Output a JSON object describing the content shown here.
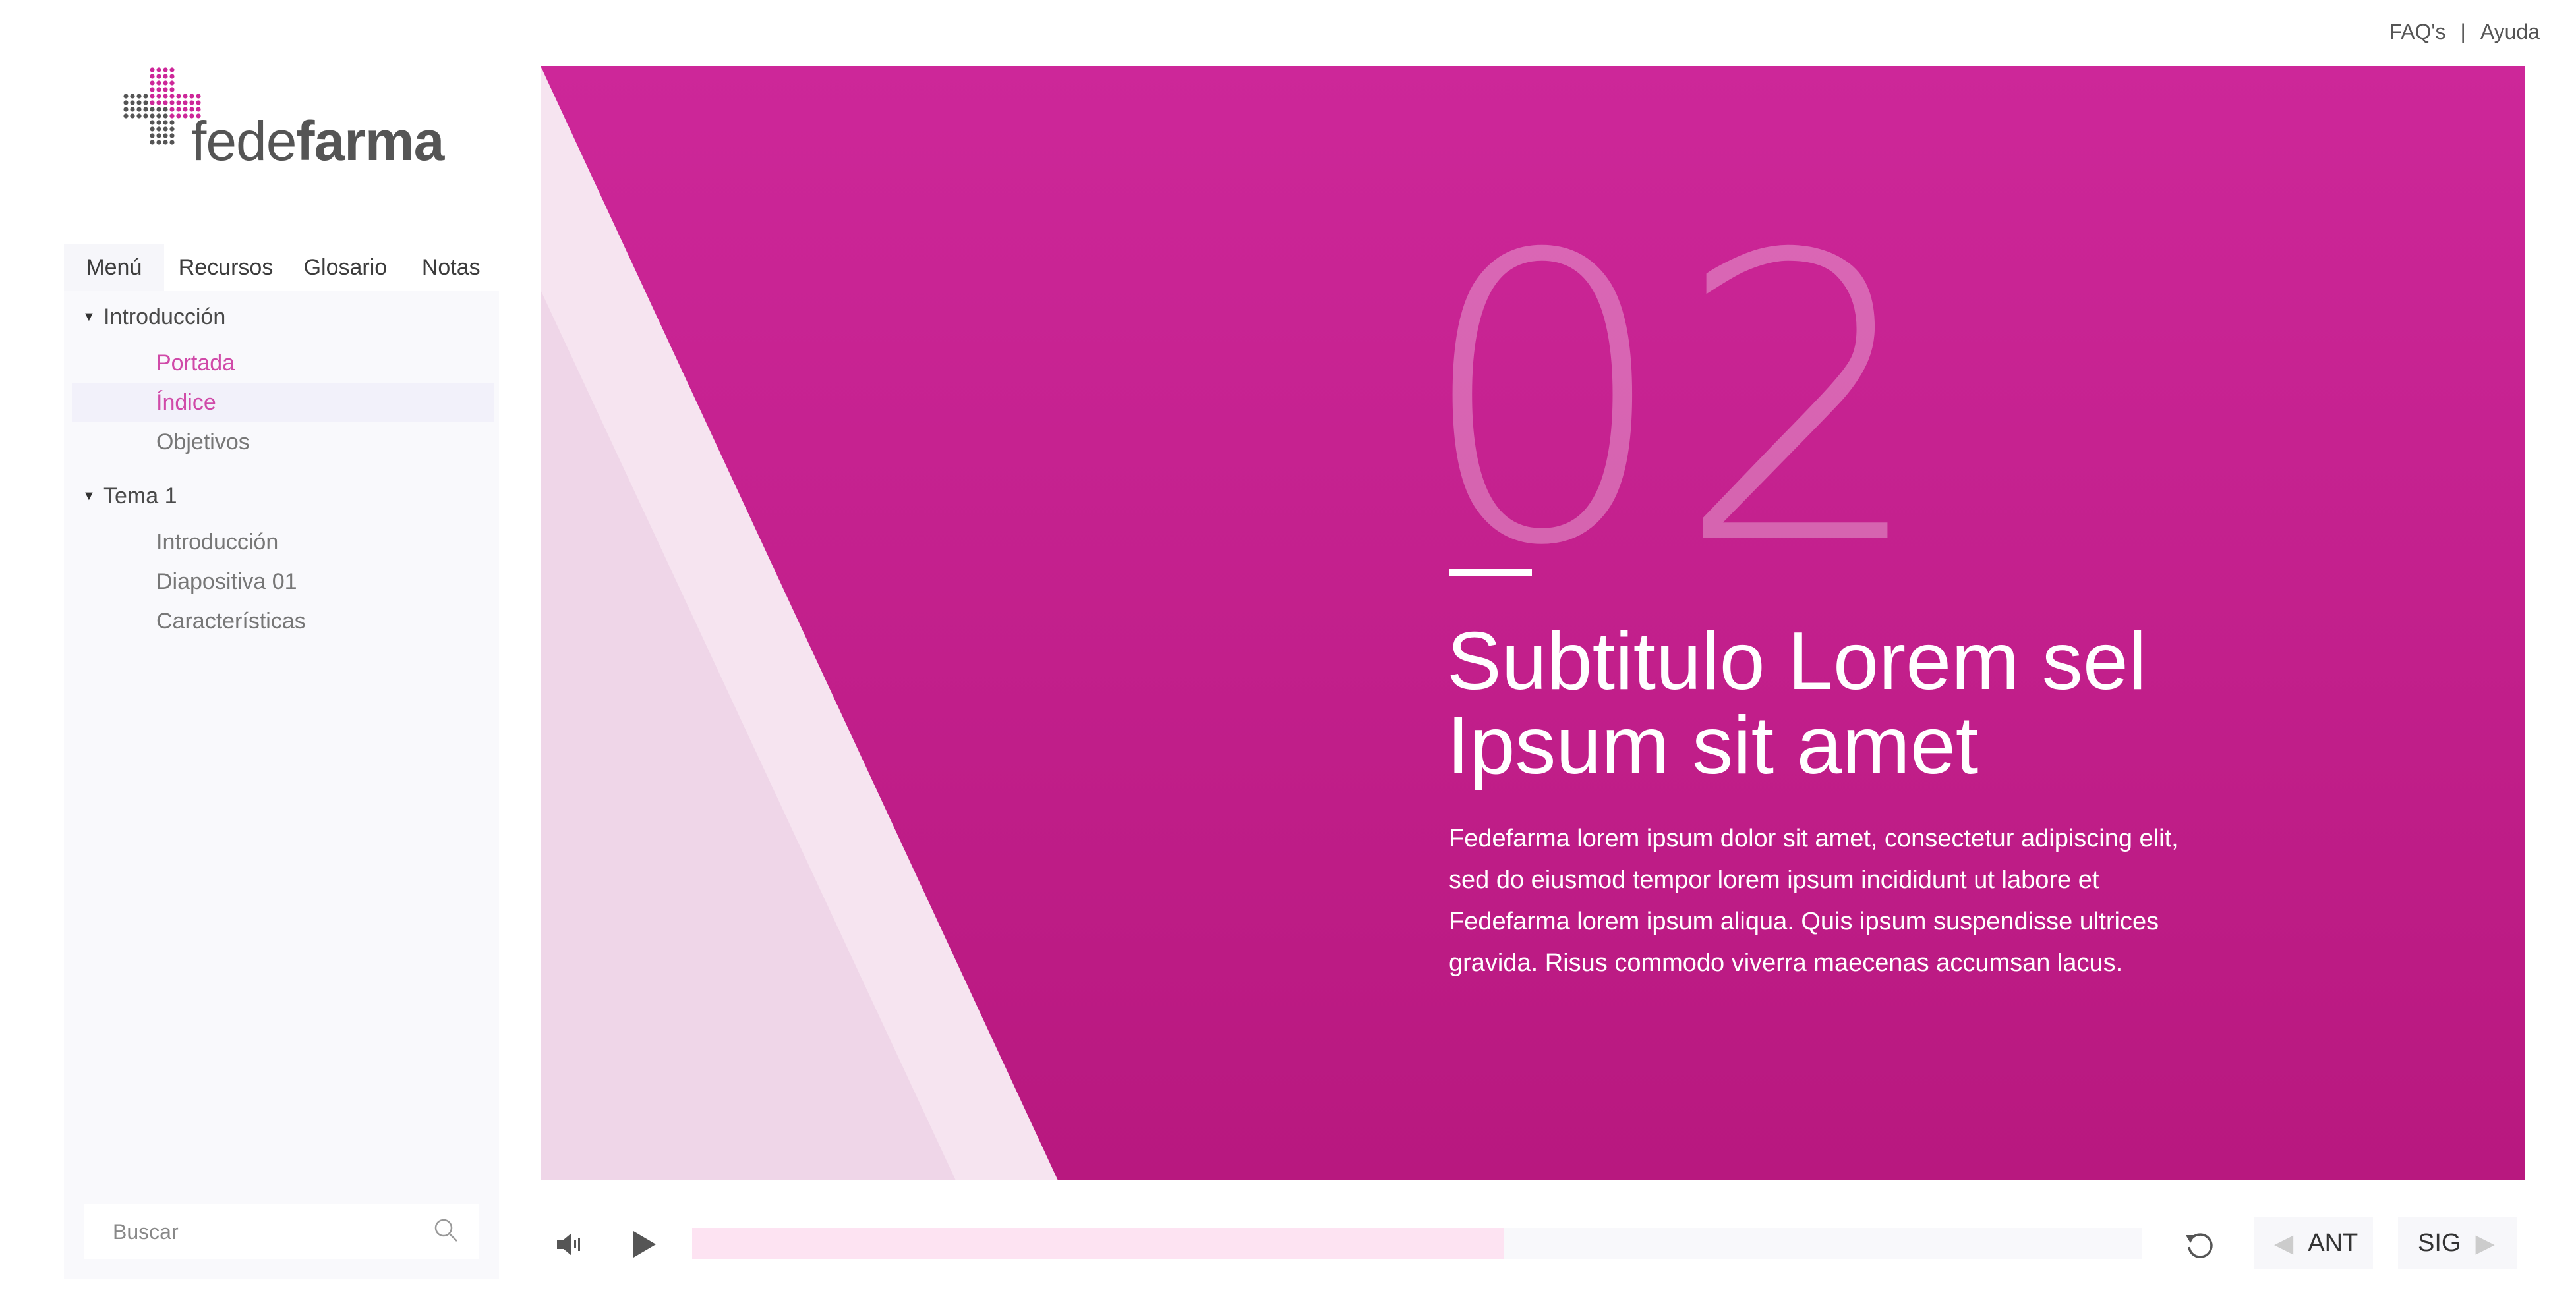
{
  "header": {
    "faq_label": "FAQ's",
    "separator": "|",
    "help_label": "Ayuda"
  },
  "logo": {
    "brand_light": "fede",
    "brand_bold": "farma",
    "accent_color": "#cd2799"
  },
  "sidebar": {
    "tabs": [
      {
        "label": "Menú",
        "active": true
      },
      {
        "label": "Recursos",
        "active": false
      },
      {
        "label": "Glosario",
        "active": false
      },
      {
        "label": "Notas",
        "active": false
      }
    ],
    "sections": [
      {
        "title": "Introducción",
        "expanded": true,
        "items": [
          {
            "label": "Portada",
            "state": "visited"
          },
          {
            "label": "Índice",
            "state": "current"
          },
          {
            "label": "Objetivos",
            "state": "default"
          }
        ]
      },
      {
        "title": "Tema 1",
        "expanded": true,
        "items": [
          {
            "label": "Introducción",
            "state": "default"
          },
          {
            "label": "Diapositiva 01",
            "state": "default"
          },
          {
            "label": "Características",
            "state": "default"
          }
        ]
      }
    ],
    "search": {
      "placeholder": "Buscar",
      "icon": "search-icon"
    }
  },
  "slide": {
    "number": "02",
    "subtitle_line1": "Subtitulo Lorem sel",
    "subtitle_line2": "Ipsum sit amet",
    "body": "Fedefarma lorem ipsum dolor sit amet, consectetur adipiscing elit, sed do eiusmod tempor  lorem ipsum incididunt ut labore et Fedefarma lorem ipsum aliqua. Quis ipsum suspendisse ultrices gravida. Risus commodo viverra maecenas accumsan lacus.",
    "background_top": "#cd2799",
    "background_bottom": "#b8187f"
  },
  "player": {
    "volume_icon": "volume-icon",
    "play_icon": "play-icon",
    "progress_fraction": 0.56,
    "progress_color": "#fde3f2",
    "replay_icon": "replay-icon",
    "prev_label": "ANT",
    "next_label": "SIG"
  }
}
